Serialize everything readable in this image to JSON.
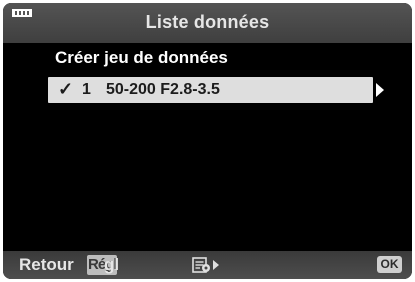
{
  "header": {
    "title": "Liste données",
    "mode_icon": "menu-tab-icon"
  },
  "menu": {
    "create_label": "Créer jeu de données",
    "items": [
      {
        "checked": true,
        "check_glyph": "✓",
        "number": "1",
        "lens": "50-200 F2.8-3.5"
      }
    ]
  },
  "footer": {
    "back_label": "Retour",
    "set_key": "Régl",
    "set_label": "gl",
    "info_icon": "info-settings-icon",
    "ok_label": "OK"
  },
  "colors": {
    "background": "#000000",
    "selection": "#dedede",
    "bar": "#4a4a4a"
  }
}
